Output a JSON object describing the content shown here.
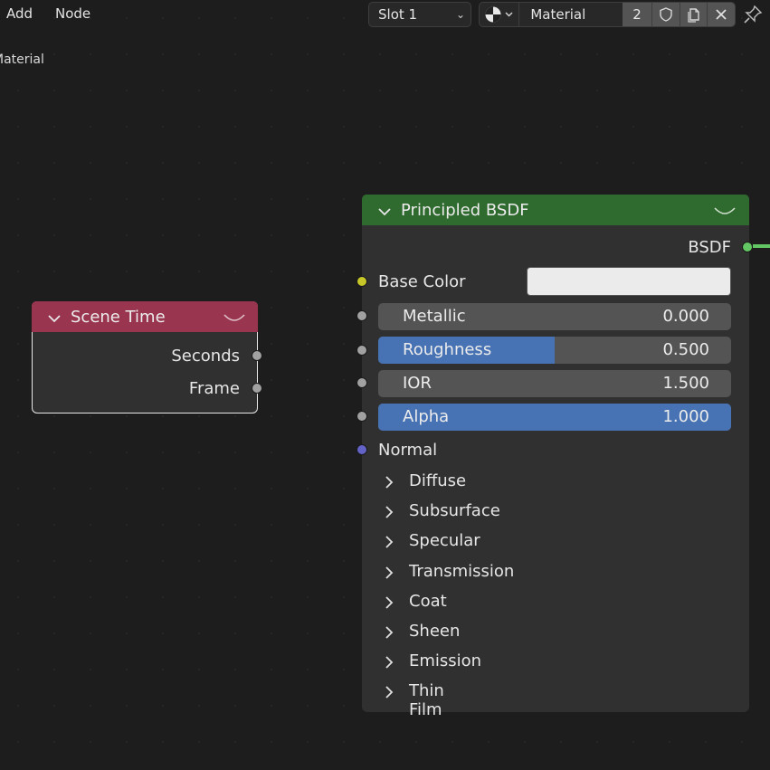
{
  "header": {
    "menu_add": "Add",
    "menu_node": "Node",
    "slot": "Slot 1",
    "material_name": "Material",
    "material_users": "2"
  },
  "tree_label": "Material",
  "icons": {
    "browse": "material-sphere-icon",
    "fake_user": "shield-icon",
    "duplicate": "duplicate-icon",
    "unlink": "close-icon",
    "pin": "pin-icon"
  },
  "scene_time": {
    "title": "Scene Time",
    "header_color": "#9a3550",
    "outputs": [
      "Seconds",
      "Frame"
    ]
  },
  "bsdf": {
    "title": "Principled BSDF",
    "header_color": "#2f6a2f",
    "output": "BSDF",
    "base_color_label": "Base Color",
    "base_color_value": "#ebebeb",
    "fields": [
      {
        "label": "Metallic",
        "value": "0.000",
        "fill": 0.0
      },
      {
        "label": "Roughness",
        "value": "0.500",
        "fill": 0.5
      },
      {
        "label": "IOR",
        "value": "1.500",
        "fill": 0.0
      },
      {
        "label": "Alpha",
        "value": "1.000",
        "fill": 1.0
      }
    ],
    "normal_label": "Normal",
    "panels": [
      "Diffuse",
      "Subsurface",
      "Specular",
      "Transmission",
      "Coat",
      "Sheen",
      "Emission",
      "Thin Film"
    ]
  },
  "colors": {
    "socket_shader": "#63c763",
    "socket_color": "#c7c729",
    "socket_float": "#a1a1a1",
    "socket_vector": "#6363c7",
    "field_fill": "#4772b3"
  }
}
